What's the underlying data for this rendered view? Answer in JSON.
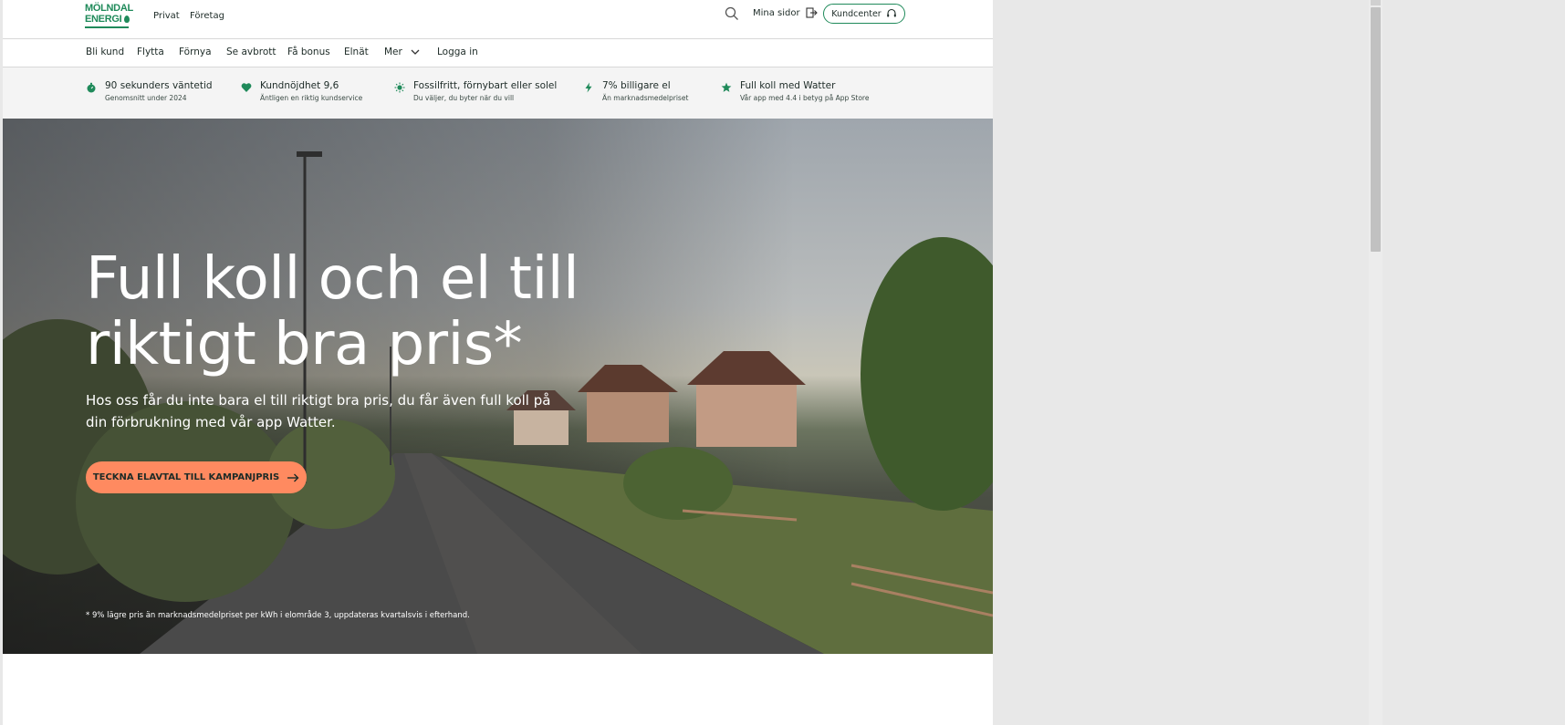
{
  "brand": {
    "line1": "MÖLNDAL",
    "line2": "ENERGI",
    "color": "#1f8a5a"
  },
  "header": {
    "segments": [
      "Privat",
      "Företag"
    ],
    "mina_sidor": "Mina sidor",
    "kundcenter": "Kundcenter"
  },
  "nav": {
    "items": [
      "Bli kund",
      "Flytta",
      "Förnya",
      "Se avbrott",
      "Få bonus",
      "Elnät",
      "Mer",
      "Logga in"
    ]
  },
  "usps": [
    {
      "icon": "stopwatch-icon",
      "title": "90 sekunders väntetid",
      "subtitle": "Genomsnitt under 2024"
    },
    {
      "icon": "heart-icon",
      "title": "Kundnöjdhet 9,6",
      "subtitle": "Äntligen en riktig kundservice"
    },
    {
      "icon": "sun-icon",
      "title": "Fossilfritt, förnybart eller solel",
      "subtitle": "Du väljer, du byter när du vill"
    },
    {
      "icon": "lightning-icon",
      "title": "7% billigare el",
      "subtitle": "Än marknadsmedelpriset"
    },
    {
      "icon": "star-icon",
      "title": "Full koll med Watter",
      "subtitle": "Vår app med 4.4 i betyg på App Store"
    }
  ],
  "hero": {
    "title": "Full koll och el till riktigt bra pris*",
    "text": "Hos oss får du inte bara el till riktigt bra pris, du får även full koll på din förbrukning med vår app Watter.",
    "cta": "TECKNA ELAVTAL TILL KAMPANJPRIS",
    "footnote": "* 9% lägre pris än marknadsmedelpriset per kWh i elområde 3, uppdateras kvartalsvis i efterhand."
  },
  "colors": {
    "accent": "#ff8a60",
    "green": "#1f8a5a"
  }
}
